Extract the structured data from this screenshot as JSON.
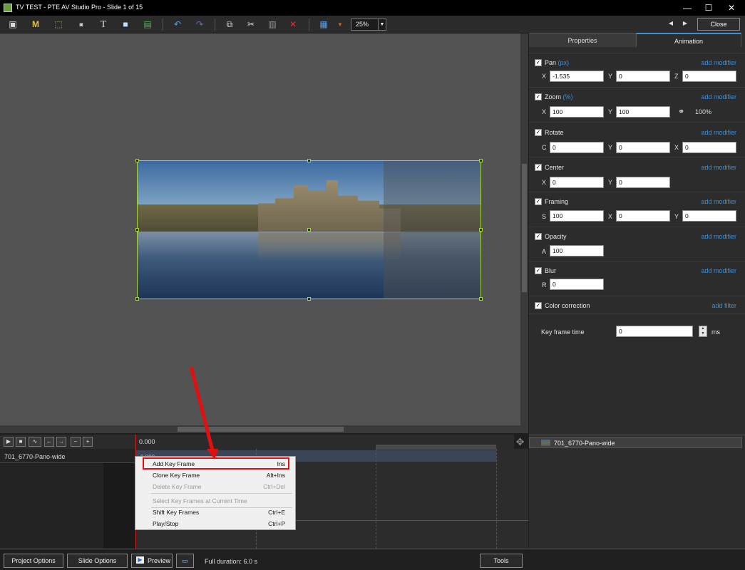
{
  "window": {
    "title": "TV TEST - PTE AV Studio Pro - Slide 1 of 15",
    "minimize": "—",
    "maximize": "☐",
    "close": "✕"
  },
  "toolbar": {
    "zoom_value": "25%",
    "close_label": "Close",
    "icons": [
      "camera-icon",
      "m-icon",
      "frame-icon",
      "ok-icon",
      "text-icon",
      "rectangle-icon",
      "image-icon",
      "undo-icon",
      "redo-icon",
      "copy-icon",
      "cut-icon",
      "paste-icon",
      "delete-icon",
      "grid-icon",
      "chevron-down-icon"
    ]
  },
  "panel": {
    "tabs": {
      "properties": "Properties",
      "animation": "Animation"
    },
    "pan": {
      "label": "Pan",
      "unit": "(px)",
      "add": "add modifier",
      "x_label": "X",
      "x": "-1.535",
      "y_label": "Y",
      "y": "0",
      "z_label": "Z",
      "z": "0"
    },
    "zoom": {
      "label": "Zoom",
      "unit": "(%)",
      "add": "add modifier",
      "x_label": "X",
      "x": "100",
      "y_label": "Y",
      "y": "100",
      "link_pct": "100%"
    },
    "rotate": {
      "label": "Rotate",
      "add": "add modifier",
      "c_label": "C",
      "c": "0",
      "y_label": "Y",
      "y": "0",
      "x_label": "X",
      "x": "0"
    },
    "center": {
      "label": "Center",
      "add": "add modifier",
      "x_label": "X",
      "x": "0",
      "y_label": "Y",
      "y": "0"
    },
    "framing": {
      "label": "Framing",
      "add": "add modifier",
      "s_label": "S",
      "s": "100",
      "x_label": "X",
      "x": "0",
      "y_label": "Y",
      "y": "0"
    },
    "opacity": {
      "label": "Opacity",
      "add": "add modifier",
      "a_label": "A",
      "a": "100"
    },
    "blur": {
      "label": "Blur",
      "add": "add modifier",
      "r_label": "R",
      "r": "0"
    },
    "color_correction": {
      "label": "Color correction",
      "add": "add filter"
    },
    "keyframe_time": {
      "label": "Key frame time",
      "value": "0",
      "unit": "ms"
    }
  },
  "timeline": {
    "buttons": [
      "▶",
      "■",
      "∿",
      "←",
      "→",
      "−",
      "+"
    ],
    "ruler_time": "0.000",
    "track_label": "701_6770-Pano-wide",
    "bar_label": "0.000"
  },
  "object_list": {
    "items": [
      {
        "name": "701_6770-Pano-wide"
      }
    ]
  },
  "context_menu": {
    "items": [
      {
        "label": "Add Key Frame",
        "shortcut": "Ins",
        "disabled": false
      },
      {
        "label": "Clone Key Frame",
        "shortcut": "Alt+Ins",
        "disabled": false
      },
      {
        "label": "Delete Key Frame",
        "shortcut": "Ctrl+Del",
        "disabled": true
      },
      {
        "label": "Select Key Frames at Current Time",
        "shortcut": "",
        "disabled": true
      },
      {
        "label": "Shift Key Frames",
        "shortcut": "Ctrl+E",
        "disabled": false
      },
      {
        "label": "Play/Stop",
        "shortcut": "Ctrl+P",
        "disabled": false
      }
    ]
  },
  "bottom": {
    "project_options": "Project Options",
    "slide_options": "Slide Options",
    "preview": "Preview",
    "full_duration": "Full duration: 6.0 s",
    "tools": "Tools"
  },
  "colors": {
    "accent": "#3d8fd9",
    "selection": "#a8d23a",
    "annotation_red": "#e01010",
    "playhead": "#d02020"
  }
}
